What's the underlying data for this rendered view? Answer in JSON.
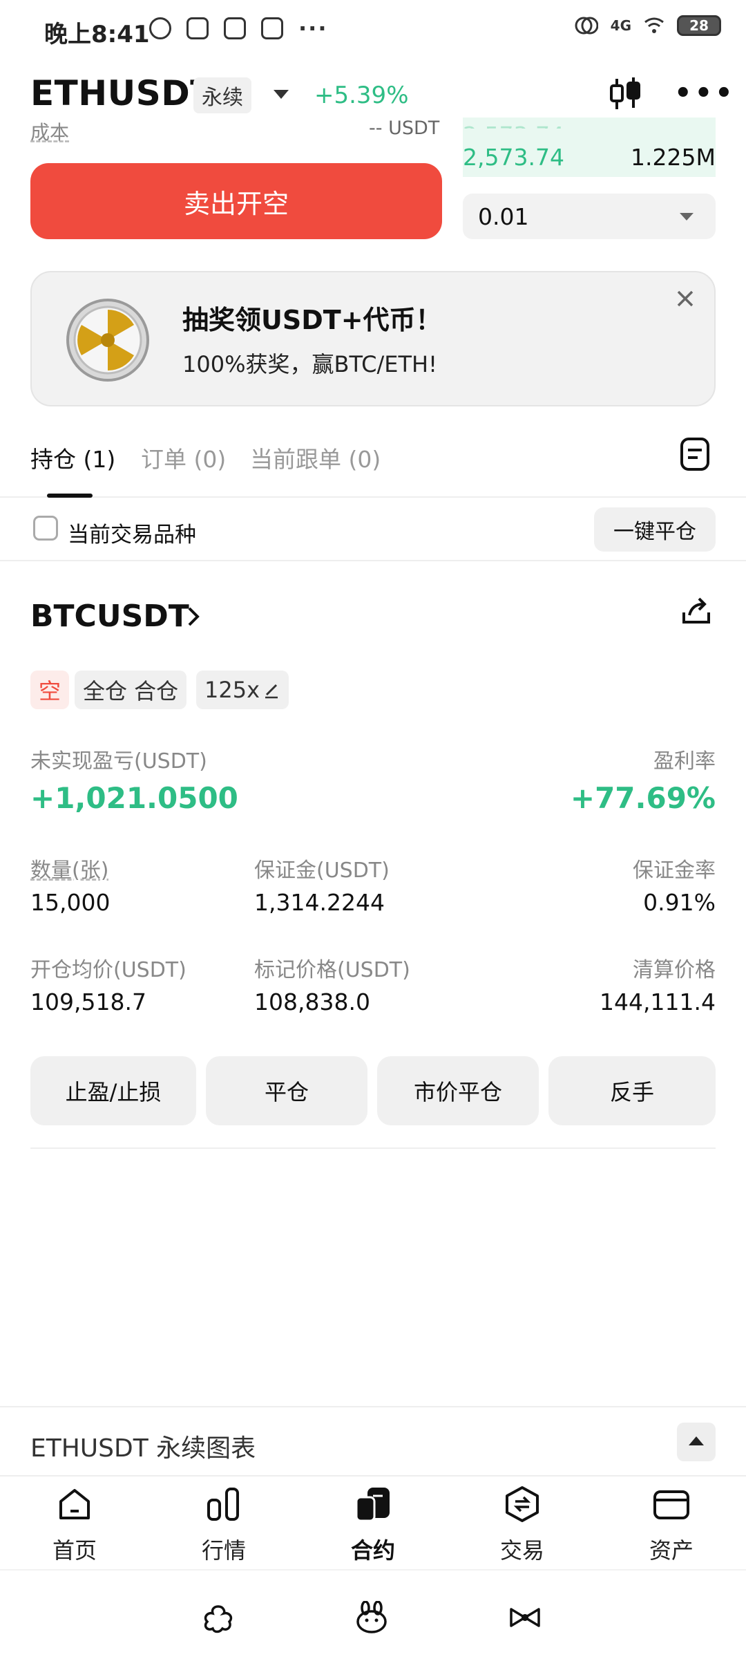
{
  "status_bar": {
    "time": "晚上8:41",
    "overflow": "···",
    "network": "4G",
    "battery": "28",
    "icons": [
      "settings-icon",
      "app-notification-icon",
      "app-notification-icon",
      "app-notification-icon",
      "vibrate-icon",
      "signal-icon",
      "wifi-icon",
      "battery-icon"
    ]
  },
  "header": {
    "symbol": "ETHUSDT",
    "contract_type": "永续",
    "change": "+5.39%",
    "icons": [
      "candlestick-chart-icon",
      "more-icon"
    ]
  },
  "order_panel": {
    "cost_label": "成本",
    "cost_value": "-- USDT",
    "sell_button": "卖出开空",
    "orderbook_partial_price": "2,573.74",
    "orderbook_partial_qty": "1.225M",
    "orderbook_price": "2,573.74",
    "orderbook_qty": "1.225M",
    "qty_step": "0.01"
  },
  "promo": {
    "title": "抽奖领USDT+代币！",
    "subtitle": "100%获奖，赢BTC/ETH!"
  },
  "tabs": [
    {
      "label": "持仓 (1)",
      "active": true
    },
    {
      "label": "订单 (0)",
      "active": false
    },
    {
      "label": "当前跟单 (0)",
      "active": false
    }
  ],
  "filter": {
    "label": "当前交易品种",
    "close_all": "一键平仓"
  },
  "position": {
    "symbol": "BTCUSDT",
    "side_tag": "空",
    "margin_mode_tag": "全仓 合仓",
    "leverage_tag": "125x",
    "unrealized_pnl_label": "未实现盈亏(USDT)",
    "unrealized_pnl_value": "+1,021.0500",
    "roe_label": "盈利率",
    "roe_value": "+77.69%",
    "size_label": "数量(张)",
    "size_value": "15,000",
    "margin_label": "保证金(USDT)",
    "margin_value": "1,314.2244",
    "margin_ratio_label": "保证金率",
    "margin_ratio_value": "0.91%",
    "entry_label": "开仓均价(USDT)",
    "entry_value": "109,518.7",
    "mark_label": "标记价格(USDT)",
    "mark_value": "108,838.0",
    "liq_label": "清算价格",
    "liq_value": "144,111.4",
    "actions": [
      "止盈/止损",
      "平仓",
      "市价平仓",
      "反手"
    ]
  },
  "chart_bar": {
    "title": "ETHUSDT 永续图表"
  },
  "bottom_nav": [
    {
      "label": "首页",
      "icon": "home-icon"
    },
    {
      "label": "行情",
      "icon": "market-bars-icon"
    },
    {
      "label": "合约",
      "icon": "futures-icon"
    },
    {
      "label": "交易",
      "icon": "trade-swap-icon"
    },
    {
      "label": "资产",
      "icon": "wallet-icon"
    }
  ],
  "system_nav": [
    "paw-icon",
    "bunny-icon",
    "bow-icon"
  ],
  "colors": {
    "green": "#2ebd85",
    "red": "#f04b3e",
    "light_gray": "#f0f0f0"
  }
}
